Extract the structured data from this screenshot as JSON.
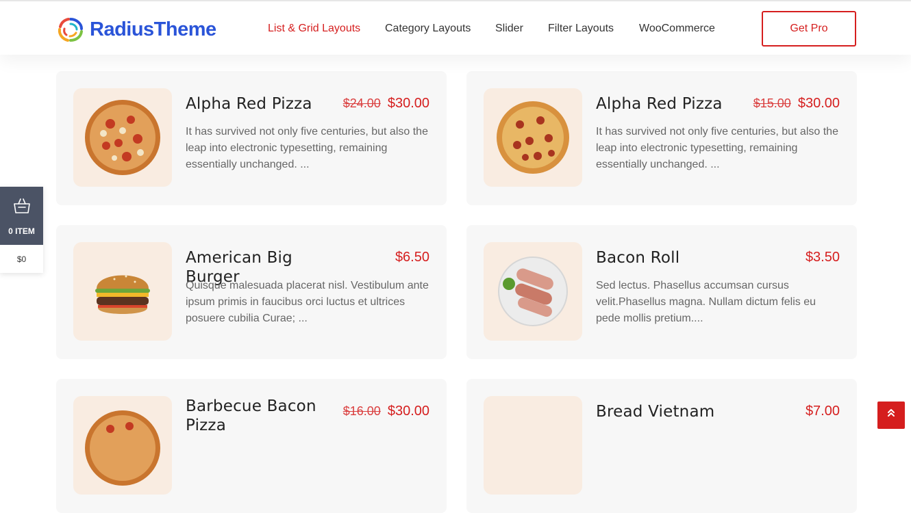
{
  "brand": {
    "name": "RadiusTheme",
    "accent": "#d51e1e",
    "brand_blue": "#2a54d8"
  },
  "nav": {
    "items": [
      {
        "label": "List & Grid Layouts",
        "active": true
      },
      {
        "label": "Category Layouts",
        "active": false
      },
      {
        "label": "Slider",
        "active": false
      },
      {
        "label": "Filter Layouts",
        "active": false
      },
      {
        "label": "WooCommerce",
        "active": false
      }
    ],
    "cta_label": "Get Pro"
  },
  "products": [
    {
      "title": "Alpha Red Pizza",
      "old_price": "$24.00",
      "price": "$30.00",
      "description": "It has survived not only five centuries, but also the leap into electronic typesetting, remaining essentially unchanged. ...",
      "image": "pizza-icon"
    },
    {
      "title": "Alpha Red Pizza",
      "old_price": "$15.00",
      "price": "$30.00",
      "description": "It has survived not only five centuries, but also the leap into electronic typesetting, remaining essentially unchanged. ...",
      "image": "pizza-icon"
    },
    {
      "title": "American Big Burger",
      "old_price": "",
      "price": "$6.50",
      "description": "Quisque malesuada placerat nisl. Vestibulum ante ipsum primis in faucibus orci luctus et ultrices posuere cubilia Curae; ...",
      "image": "burger-icon"
    },
    {
      "title": "Bacon Roll",
      "old_price": "",
      "price": "$3.50",
      "description": "Sed lectus. Phasellus accumsan cursus velit.Phasellus magna. Nullam dictum felis eu pede mollis pretium....",
      "image": "bacon-roll-icon"
    },
    {
      "title": "Barbecue Bacon Pizza",
      "old_price": "$16.00",
      "price": "$30.00",
      "description": "",
      "image": "pizza-icon"
    },
    {
      "title": "Bread Vietnam",
      "old_price": "",
      "price": "$7.00",
      "description": "",
      "image": "bread-icon"
    }
  ],
  "cart": {
    "count_label": "0 ITEM",
    "total": "$0",
    "icon": "basket-icon"
  },
  "scroll_top": {
    "icon": "double-chevron-up-icon"
  }
}
